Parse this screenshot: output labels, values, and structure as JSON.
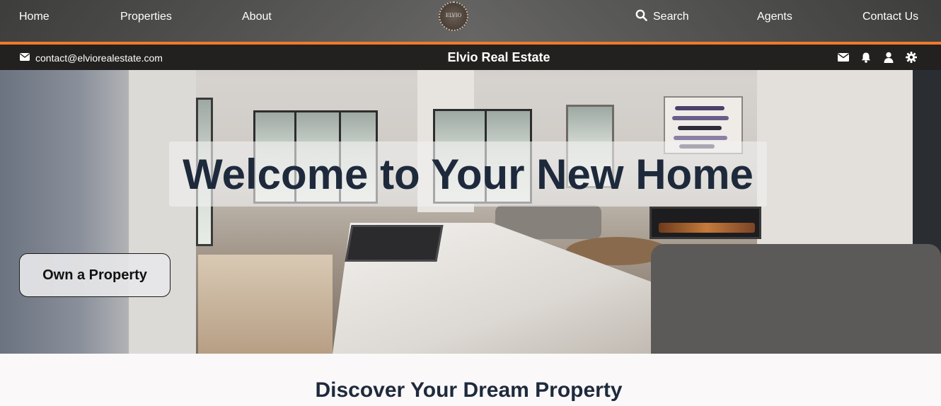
{
  "nav": {
    "home": "Home",
    "properties": "Properties",
    "about": "About",
    "logo_text": "ELVIO",
    "search": "Search",
    "agents": "Agents",
    "contact": "Contact Us"
  },
  "subbar": {
    "email": "contact@elviorealestate.com",
    "brand": "Elvio Real Estate",
    "icons": [
      "envelope-icon",
      "bell-icon",
      "user-icon",
      "gear-icon"
    ]
  },
  "hero": {
    "title": "Welcome to Your New Home",
    "cta": "Own a Property"
  },
  "section": {
    "title": "Discover Your Dream Property"
  },
  "colors": {
    "accent": "#f07a2a",
    "heading": "#1e2a3c",
    "subbar_bg": "#222120"
  }
}
